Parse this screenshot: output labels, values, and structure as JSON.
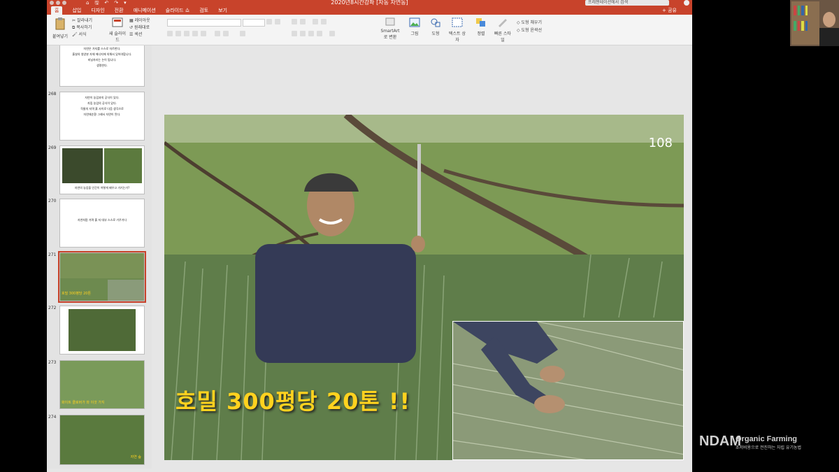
{
  "window": {
    "title": "2020년8시간강좌 [자농 자연농]"
  },
  "quick_access": [
    "⌂",
    "🖫",
    "↶",
    "↷",
    "▾"
  ],
  "search": {
    "placeholder": "프레젠테이션에서 검색"
  },
  "tabs": [
    "홈",
    "삽입",
    "디자인",
    "전환",
    "애니메이션",
    "슬라이드 쇼",
    "검토",
    "보기"
  ],
  "share_label": "+ 공유",
  "ribbon": {
    "paste": "붙여넣기",
    "cut": "잘라내기",
    "copy": "복사하기",
    "format": "서식",
    "new_slide": "새 슬라이드",
    "layout": "레이아웃",
    "reset": "원래대로",
    "section": "섹션",
    "convert_smartart": "SmartArt로 변환",
    "picture": "그림",
    "shapes": "도형",
    "textbox": "텍스트 상자",
    "arrange": "정렬",
    "quick_styles": "빠른 스타일",
    "shape_fill": "도형 채우기",
    "shape_outline": "도형 윤곽선"
  },
  "thumbnails": [
    {
      "num": "",
      "lines": [
        "자연은 가지를 스스로 자르한다.",
        "흙살의 영양분 자체 에너지에 의해서 있어야합니다.",
        "비닐자라는 논이 됩니다.",
        "생명한다."
      ]
    },
    {
      "num": "268",
      "lines": [
        "자연이 농업과의 공식이 있다.",
        "자립 농업의 공식이 있다.",
        "작물의 지역 흙 사이로 다음 생긱으로",
        "자연재순환 그래서 자연이 된다."
      ]
    },
    {
      "num": "269",
      "caption": "자연의 농업을 인간이 어떻게 배우고 가기는가?"
    },
    {
      "num": "270",
      "caption": "자연처럼 가며 흙 저 대부 스스로 가꾸기다"
    },
    {
      "num": "271",
      "caption": "호밀 300평당 20톤"
    },
    {
      "num": "272"
    },
    {
      "num": "273",
      "caption": "화이트 클로버가 와 이것 가지"
    },
    {
      "num": "274",
      "caption": "자연 숲"
    }
  ],
  "slide": {
    "number": "108",
    "caption": "호밀 300평당 20톤 !!"
  },
  "watermark": {
    "logo": "NDAM",
    "title": "Organic Farming",
    "subtitle": "초저비용으로 전진하는 자립 유기농법"
  }
}
